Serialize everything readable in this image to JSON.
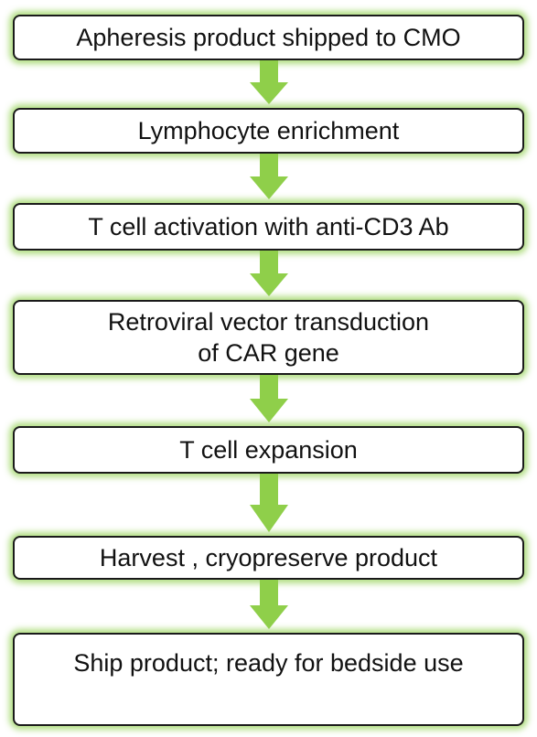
{
  "steps": [
    {
      "label": "Apheresis product shipped to CMO"
    },
    {
      "label": "Lymphocyte enrichment"
    },
    {
      "label": "T cell activation with anti-CD3 Ab"
    },
    {
      "label": "Retroviral vector transduction\nof CAR gene"
    },
    {
      "label": "T cell expansion"
    },
    {
      "label": "Harvest , cryopreserve product"
    },
    {
      "label": "Ship product; ready for bedside use"
    }
  ],
  "colors": {
    "arrow": "#8fcf4a",
    "glow": "#92d050",
    "border": "#1a1a1a"
  }
}
